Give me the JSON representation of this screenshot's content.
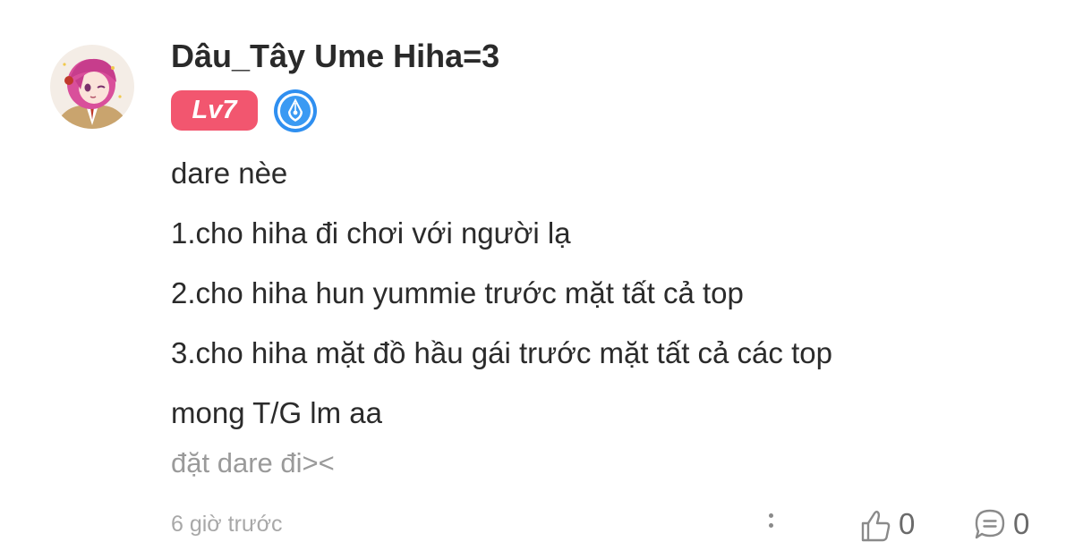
{
  "author": {
    "name": "Dâu_Tây Ume Hiha=3",
    "level": "Lv7",
    "avatar_icon": "anime-girl-avatar",
    "badge_icon": "pen-nib-badge-icon"
  },
  "post": {
    "lines": [
      "dare nèe",
      "1.cho hiha đi chơi với người lạ",
      "2.cho hiha hun yummie trước mặt tất cả top",
      "3.cho hiha mặt đồ hầu gái trước mặt tất cả các top",
      "mong T/G lm aa"
    ],
    "subtext": "đặt dare đi><"
  },
  "footer": {
    "timestamp": "6 giờ trước",
    "like_count": "0",
    "comment_count": "0"
  },
  "colors": {
    "level_badge": "#f2566f",
    "writer_badge": "#2f8ff0",
    "text": "#2b2b2b",
    "muted": "#9a9a9a"
  }
}
